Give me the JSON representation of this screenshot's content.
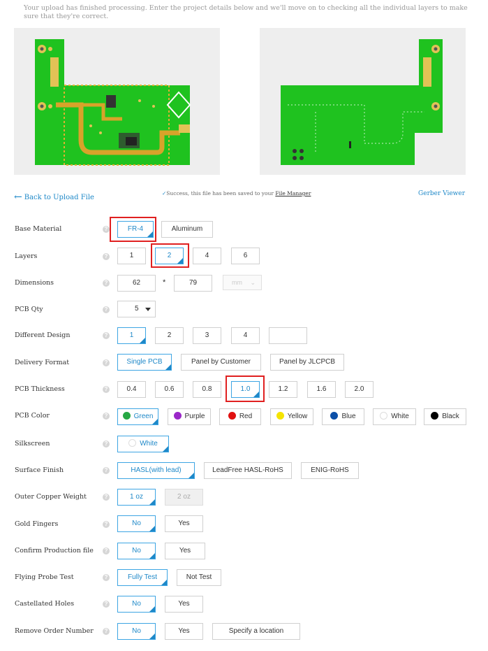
{
  "notice": "Your upload has finished processing. Enter the project details below and we'll move on to checking all the individual layers to make sure that they're correct.",
  "links": {
    "back": "Back to Upload File",
    "success_prefix": "Success, this file has been saved to your",
    "file_manager": "File Manager",
    "gerber_viewer": "Gerber Viewer"
  },
  "labels": {
    "base_material": "Base Material",
    "layers": "Layers",
    "dimensions": "Dimensions",
    "pcb_qty": "PCB Qty",
    "different_design": "Different Design",
    "delivery_format": "Delivery Format",
    "pcb_thickness": "PCB Thickness",
    "pcb_color": "PCB Color",
    "silkscreen": "Silkscreen",
    "surface_finish": "Surface Finish",
    "outer_copper": "Outer Copper Weight",
    "gold_fingers": "Gold Fingers",
    "confirm_production": "Confirm Production file",
    "flying_probe": "Flying Probe Test",
    "castellated": "Castellated Holes",
    "remove_order": "Remove Order Number"
  },
  "help_glyph": "?",
  "options": {
    "base_material": [
      "FR-4",
      "Aluminum"
    ],
    "layers": [
      "1",
      "2",
      "4",
      "6"
    ],
    "dim_width": "62",
    "dim_times": "*",
    "dim_height": "79",
    "dim_unit": "mm",
    "pcb_qty": "5",
    "different_design": [
      "1",
      "2",
      "3",
      "4"
    ],
    "delivery_format": [
      "Single PCB",
      "Panel by Customer",
      "Panel by JLCPCB"
    ],
    "pcb_thickness": [
      "0.4",
      "0.6",
      "0.8",
      "1.0",
      "1.2",
      "1.6",
      "2.0"
    ],
    "pcb_color": [
      "Green",
      "Purple",
      "Red",
      "Yellow",
      "Blue",
      "White",
      "Black"
    ],
    "silkscreen": "White",
    "surface_finish": [
      "HASL(with lead)",
      "LeadFree HASL-RoHS",
      "ENIG-RoHS"
    ],
    "outer_copper": [
      "1 oz",
      "2 oz"
    ],
    "gold_fingers": [
      "No",
      "Yes"
    ],
    "confirm_production": [
      "No",
      "Yes"
    ],
    "flying_probe": [
      "Fully Test",
      "Not Test"
    ],
    "castellated": [
      "No",
      "Yes"
    ],
    "remove_order": [
      "No",
      "Yes",
      "Specify a location"
    ]
  },
  "colors": {
    "accent": "#1e88c8",
    "highlight": "#e02020",
    "pcb_green": "#1fc21f",
    "trace_gold": "#d8a32a",
    "swatch_green": "#27a844",
    "swatch_purple": "#9a27c8",
    "swatch_red": "#e01010",
    "swatch_yellow": "#f5e400",
    "swatch_blue": "#0c4fa8",
    "swatch_white": "#ffffff",
    "swatch_black": "#000000"
  },
  "selected": {
    "base_material": "FR-4",
    "layers": "2",
    "pcb_thickness": "1.0",
    "pcb_color": "Green"
  }
}
